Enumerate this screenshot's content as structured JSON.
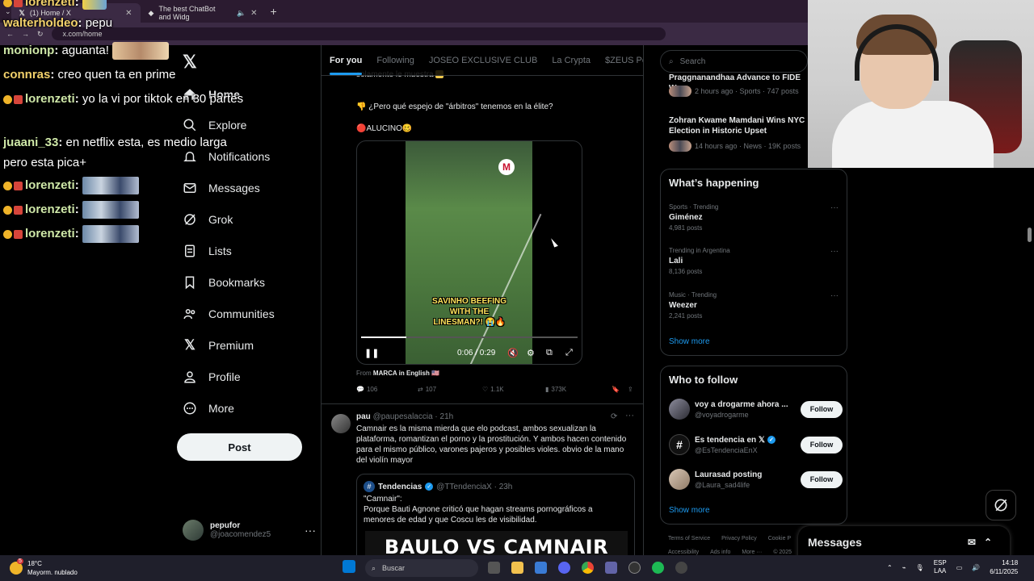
{
  "browser": {
    "tabs": [
      {
        "title": "(1) Home / X",
        "active": true
      },
      {
        "title": "The best ChatBot and Widg",
        "active": false
      }
    ],
    "url": "x.com/home"
  },
  "chat": {
    "lines": [
      {
        "user": "lorenzeti",
        "msg": ""
      },
      {
        "user": "walterholdeo",
        "msg": "pepu"
      },
      {
        "user": "monionp",
        "msg": "aguanta!"
      },
      {
        "user": "connras",
        "msg": "creo quen ta en prime"
      },
      {
        "user": "lorenzeti",
        "msg": "yo la vi por tiktok en 30 partes"
      },
      {
        "user": "juaani_33",
        "msg": "en netflix esta, es medio larga pero esta pica+"
      },
      {
        "user": "lorenzeti",
        "msg": ""
      },
      {
        "user": "lorenzeti",
        "msg": ""
      },
      {
        "user": "lorenzeti",
        "msg": ""
      }
    ]
  },
  "nav": {
    "items": [
      "Home",
      "Explore",
      "Notifications",
      "Messages",
      "Grok",
      "Lists",
      "Bookmarks",
      "Communities",
      "Premium",
      "Profile",
      "More"
    ],
    "post_label": "Post",
    "account_name": "pepufor",
    "account_handle": "@joacomendez5"
  },
  "feed": {
    "tabs": [
      "For you",
      "Following",
      "JOSEO EXCLUSIVE CLUB",
      "La Crypta",
      "$ZEUS Pepe's"
    ],
    "post1": {
      "line1": "solamente le muestra",
      "line2": "¿Pero qué espejo de \"árbitros\" tenemos en la élite?",
      "line3": "ALUCINO",
      "video_caption": "SAVINHO BEEFING WITH THE LINESMAN?!",
      "video_logo": "M",
      "time": "0:06 / 0:29",
      "progress": 0.21,
      "from_label": "From",
      "from_source": "MARCA in English",
      "replies": "106",
      "reposts": "107",
      "likes": "1.1K",
      "views": "373K"
    },
    "post2": {
      "name": "pau",
      "handle": "@paupesalaccia · 21h",
      "text": "Camnair es la misma mierda que elo podcast, ambos sexualizan la plataforma, romantizan el porno y la prostitución. Y ambos hacen contenido para el mismo público, varones pajeros y posibles violes. obvio de la mano del violín mayor",
      "quote": {
        "name": "Tendencias",
        "handle": "@TTendenciaX · 23h",
        "text1": "\"Camnair\":",
        "text2": "Porque Bauti Agnone criticó que hagan streams pornográficos a menores de edad y que Coscu les de visibilidad.",
        "banner": "BAULO VS CAMNAIR"
      }
    }
  },
  "right": {
    "search_placeholder": "Search",
    "news": [
      {
        "title": "Praggnanandhaa Advance to FIDE W",
        "meta": "2 hours ago · Sports · 747 posts"
      },
      {
        "title": "Zohran Kwame Mamdani Wins NYC Election in Historic Upset",
        "meta": "14 hours ago · News · 19K posts"
      }
    ],
    "happening_title": "What’s happening",
    "trends": [
      {
        "context": "Sports · Trending",
        "name": "Giménez",
        "count": "4,981 posts"
      },
      {
        "context": "Trending in Argentina",
        "name": "Lali",
        "count": "8,136 posts"
      },
      {
        "context": "Music · Trending",
        "name": "Weezer",
        "count": "2,241 posts"
      }
    ],
    "show_more": "Show more",
    "wtf_title": "Who to follow",
    "wtf": [
      {
        "name": "voy a drogarme ahora ...",
        "handle": "@voyadrogarme",
        "verified": false
      },
      {
        "name": "Es tendencia en 𝕏",
        "handle": "@EsTendenciaEnX",
        "verified": true
      },
      {
        "name": "Laurasad posting",
        "handle": "@Laura_sad4life",
        "verified": false
      }
    ],
    "follow_label": "Follow",
    "footer1": [
      "Terms of Service",
      "Privacy Policy",
      "Cookie P"
    ],
    "footer2": [
      "Accessibility",
      "Ads info",
      "More ···",
      "© 2025"
    ]
  },
  "messages_drawer": "Messages",
  "taskbar": {
    "temp": "18°C",
    "weather": "Mayorm. nublado",
    "search": "Buscar",
    "lang1": "ESP",
    "lang2": "LAA",
    "time": "14:18",
    "date": "6/11/2025",
    "weather_badge": "5"
  },
  "colors": {
    "accent": "#1d9bf0",
    "bg": "#000000",
    "border": "#2f3336",
    "muted": "#71767b"
  }
}
